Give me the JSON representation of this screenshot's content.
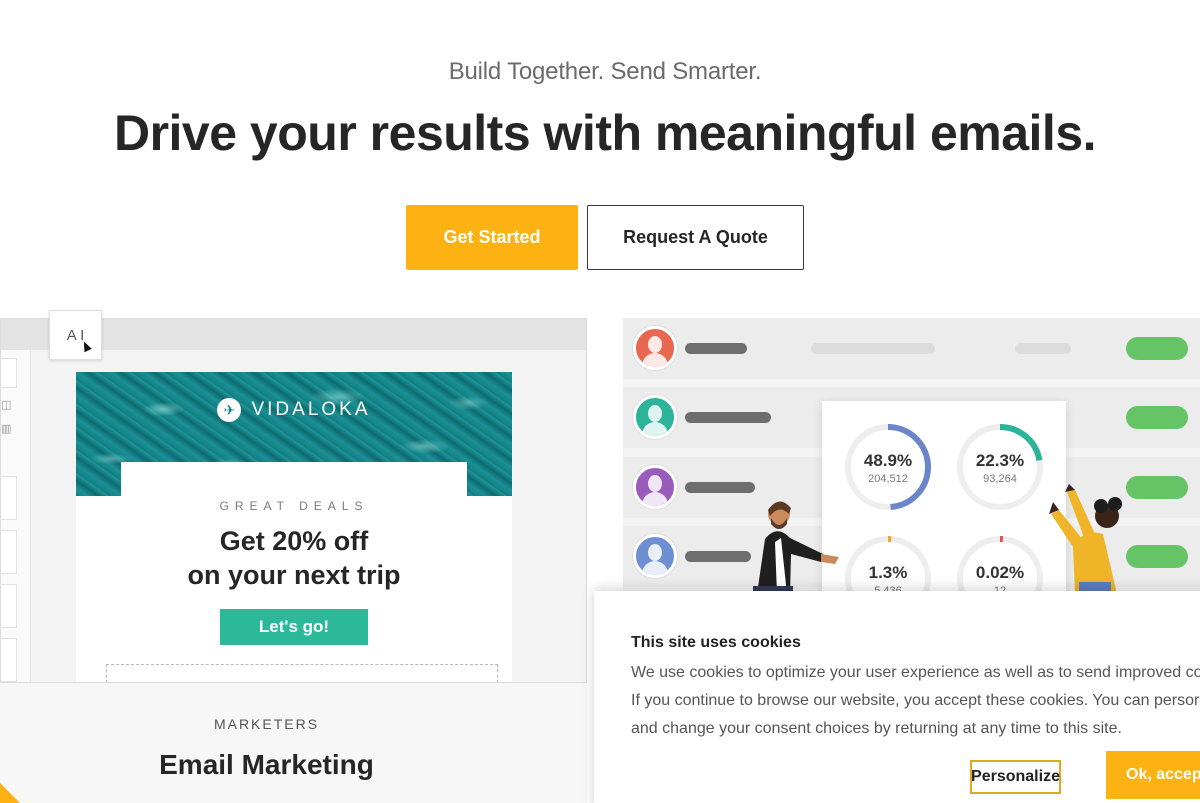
{
  "hero": {
    "subtitle": "Build Together. Send Smarter.",
    "headline": "Drive your results with meaningful emails.",
    "primary_cta": "Get Started",
    "secondary_cta": "Request A Quote"
  },
  "email_preview": {
    "brand": "VIDALOKA",
    "brand_icon": "airplane-icon",
    "eyebrow": "GREAT DEALS",
    "offer_line1": "Get 20% off",
    "offer_line2": "on your next trip",
    "cta": "Let's go!",
    "text_tool_label": "A I"
  },
  "feature_card": {
    "eyebrow": "MARKETERS",
    "title": "Email Marketing"
  },
  "contacts": {
    "avatar_colors": [
      "#e8674f",
      "#2bb49a",
      "#9b5bbd",
      "#6f8fd3"
    ],
    "status_color": "#66c466"
  },
  "stats": [
    {
      "percent": "48.9%",
      "count": "204,512",
      "color": "#6b86c8",
      "fraction": 0.489
    },
    {
      "percent": "22.3%",
      "count": "93,264",
      "color": "#2bb49a",
      "fraction": 0.223
    },
    {
      "percent": "1.3%",
      "count": "5,436",
      "color": "#f5a623",
      "fraction": 0.013
    },
    {
      "percent": "0.02%",
      "count": "12",
      "color": "#e0524a",
      "fraction": 0.0002
    }
  ],
  "cookie_banner": {
    "title": "This site uses cookies",
    "line1": "We use cookies to optimize your user experience as well as to send improved cor",
    "line2": "If you continue to browse our website, you accept these cookies. You can persor",
    "line3": "and change your consent choices by returning at any time to this site.",
    "personalize": "Personalize",
    "accept": "Ok, accept"
  },
  "colors": {
    "brand_yellow": "#fcb212",
    "teal": "#2cb99a"
  }
}
